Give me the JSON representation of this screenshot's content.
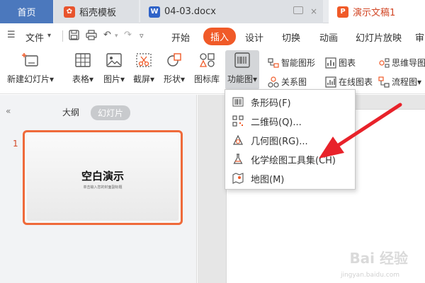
{
  "tabs": {
    "home": "首页",
    "daoke": "稻壳模板",
    "doc": "04-03.docx",
    "ppt": "演示文稿1"
  },
  "menu": {
    "file": "文件",
    "items": [
      "开始",
      "插入",
      "设计",
      "切换",
      "动画",
      "幻灯片放映",
      "审"
    ],
    "active": "插入"
  },
  "ribbon": {
    "new_slide": "新建幻灯片",
    "table": "表格",
    "picture": "图片",
    "screenshot": "截屏",
    "shape": "形状",
    "icon_lib": "图标库",
    "function_chart": "功能图",
    "smart_graphic": "智能图形",
    "chart": "图表",
    "mind_map": "思维导图",
    "relation_chart": "关系图",
    "online_chart": "在线图表",
    "flowchart": "流程图"
  },
  "left_panel": {
    "outline_tab": "大纲",
    "slides_tab": "幻灯片",
    "slide_number": "1",
    "thumb_title": "空白演示",
    "thumb_subtitle": "单击输入您的封面副标题"
  },
  "dropdown": {
    "items": [
      {
        "label": "条形码(F)",
        "icon": "barcode-icon"
      },
      {
        "label": "二维码(Q)...",
        "icon": "qr-code-icon"
      },
      {
        "label": "几何图(RG)...",
        "icon": "geometry-icon"
      },
      {
        "label": "化学绘图工具集(CH)",
        "icon": "flask-icon"
      },
      {
        "label": "地图(M)",
        "icon": "map-icon"
      }
    ]
  },
  "watermark": {
    "brand": "Bai 经验",
    "url": "jingyan.baidu.com"
  },
  "colors": {
    "accent": "#f05a28",
    "home_tab": "#4b78bd",
    "arrow": "#e8222a"
  }
}
